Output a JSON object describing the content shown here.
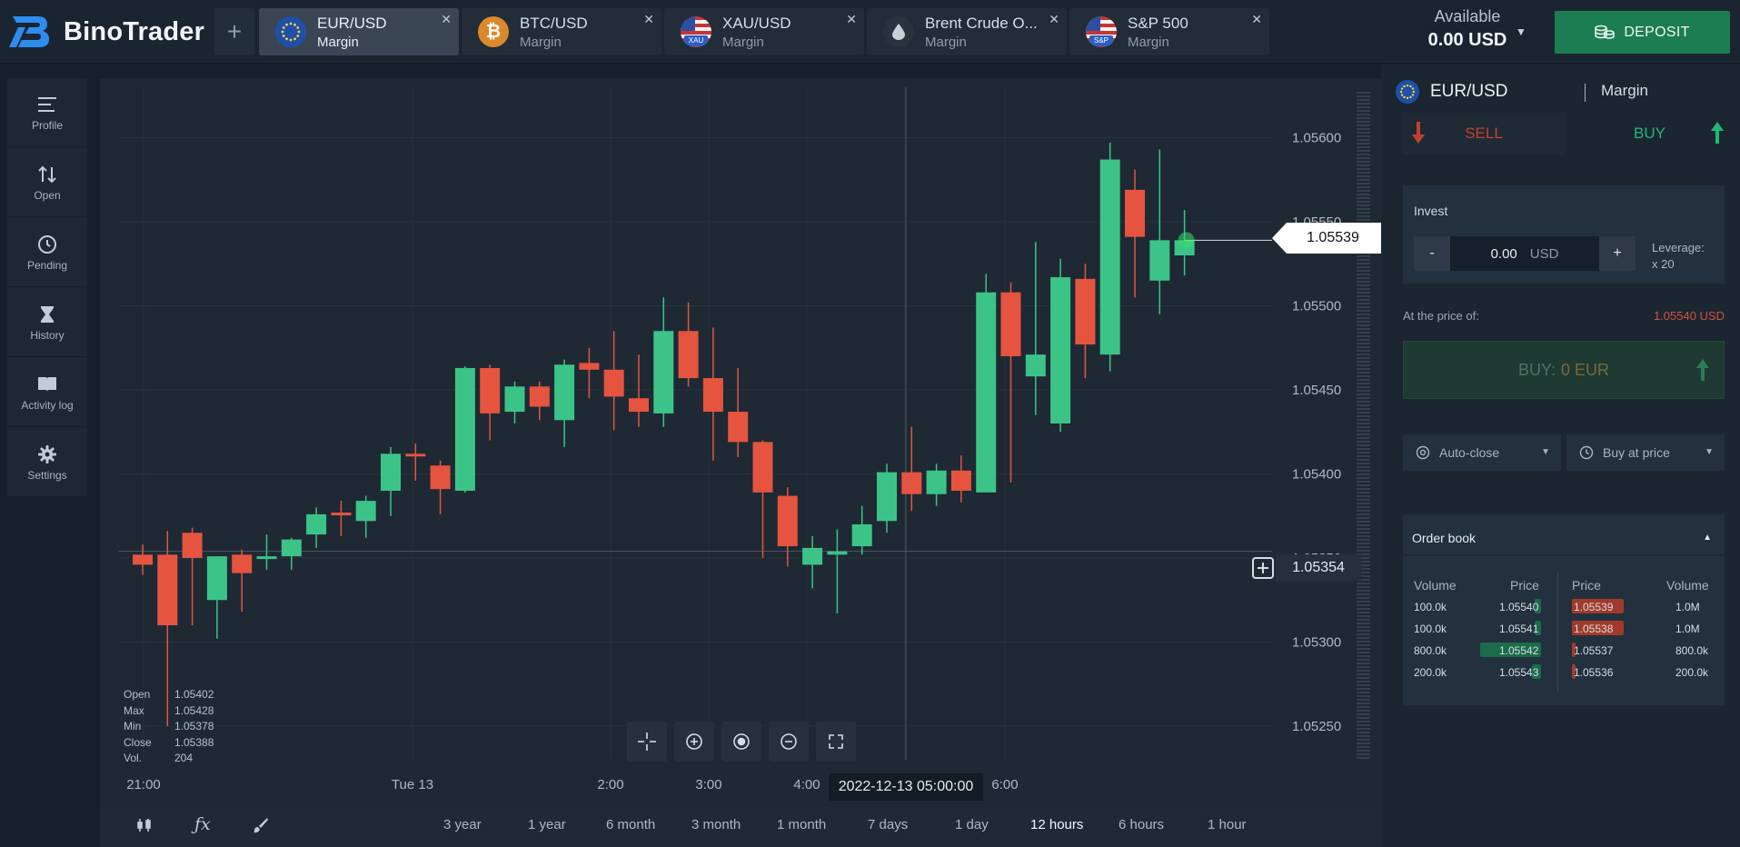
{
  "app": {
    "brand": "BinoTrader"
  },
  "tabs": [
    {
      "symbol": "EUR/USD",
      "mode": "Margin",
      "active": true,
      "flag": "eu-flag-icon"
    },
    {
      "symbol": "BTC/USD",
      "mode": "Margin",
      "active": false,
      "flag": "bitcoin-icon"
    },
    {
      "symbol": "XAU/USD",
      "mode": "Margin",
      "active": false,
      "flag": "us-flag-icon",
      "badge": "XAU"
    },
    {
      "symbol": "Brent Crude O...",
      "mode": "Margin",
      "active": false,
      "flag": "oil-drop-icon"
    },
    {
      "symbol": "S&P 500",
      "mode": "Margin",
      "active": false,
      "flag": "us-flag-icon",
      "badge": "S&P"
    }
  ],
  "account": {
    "available_label": "Available",
    "balance": "0.00 USD",
    "deposit_label": "DEPOSIT"
  },
  "nav": [
    {
      "label": "Profile",
      "icon": "menu-icon"
    },
    {
      "label": "Open",
      "icon": "sort-arrows-icon"
    },
    {
      "label": "Pending",
      "icon": "clock-icon"
    },
    {
      "label": "History",
      "icon": "hourglass-icon"
    },
    {
      "label": "Activity log",
      "icon": "book-icon"
    },
    {
      "label": "Settings",
      "icon": "gear-icon"
    }
  ],
  "chart": {
    "current_price": "1.05539",
    "crosshair_price": "1.05354",
    "crosshair_time": "2022-12-13 05:00:00",
    "ohlc": [
      {
        "k": "Open",
        "v": "1.05402"
      },
      {
        "k": "Max",
        "v": "1.05428"
      },
      {
        "k": "Min",
        "v": "1.05378"
      },
      {
        "k": "Close",
        "v": "1.05388"
      },
      {
        "k": "Vol.",
        "v": "204"
      }
    ]
  },
  "chart_data": {
    "type": "candlestick",
    "y_ticks": [
      "1.05600",
      "1.05550",
      "1.05500",
      "1.05450",
      "1.05400",
      "1.05350",
      "1.05300",
      "1.05250"
    ],
    "ylim": [
      1.0523,
      1.0563
    ],
    "x_ticks": [
      "21:00",
      "Tue 13",
      "2:00",
      "3:00",
      "4:00",
      "5:00",
      "6:00"
    ],
    "colors": {
      "up": "#3cc488",
      "down": "#e5543f"
    },
    "candles": [
      [
        1.05352,
        1.05346,
        1.05358,
        1.0534
      ],
      [
        1.05352,
        1.0531,
        1.05366,
        1.0525
      ],
      [
        1.05365,
        1.0535,
        1.05368,
        1.0531
      ],
      [
        1.05325,
        1.05351,
        1.05351,
        1.05302
      ],
      [
        1.05352,
        1.05341,
        1.05355,
        1.05318
      ],
      [
        1.0535,
        1.05351,
        1.05364,
        1.05343
      ],
      [
        1.05351,
        1.05361,
        1.05362,
        1.05343
      ],
      [
        1.05364,
        1.05376,
        1.0538,
        1.05356
      ],
      [
        1.05377,
        1.05376,
        1.05384,
        1.05363
      ],
      [
        1.05372,
        1.05384,
        1.05387,
        1.05362
      ],
      [
        1.0539,
        1.05412,
        1.05416,
        1.05375
      ],
      [
        1.05412,
        1.05411,
        1.05418,
        1.05396
      ],
      [
        1.05405,
        1.05391,
        1.05408,
        1.05376
      ],
      [
        1.0539,
        1.05463,
        1.05464,
        1.05389
      ],
      [
        1.05463,
        1.05436,
        1.05465,
        1.0542
      ],
      [
        1.05437,
        1.05452,
        1.05455,
        1.0543
      ],
      [
        1.05452,
        1.0544,
        1.05455,
        1.05432
      ],
      [
        1.05432,
        1.05465,
        1.05468,
        1.05416
      ],
      [
        1.05466,
        1.05462,
        1.05475,
        1.05445
      ],
      [
        1.05462,
        1.05446,
        1.05485,
        1.05426
      ],
      [
        1.05445,
        1.05437,
        1.05471,
        1.05428
      ],
      [
        1.05436,
        1.05485,
        1.05505,
        1.05428
      ],
      [
        1.05485,
        1.05457,
        1.05502,
        1.05452
      ],
      [
        1.05457,
        1.05437,
        1.05487,
        1.05408
      ],
      [
        1.05437,
        1.05419,
        1.05463,
        1.0541
      ],
      [
        1.05419,
        1.05389,
        1.0542,
        1.0535
      ],
      [
        1.05387,
        1.05357,
        1.05392,
        1.05345
      ],
      [
        1.05346,
        1.05356,
        1.05363,
        1.05332
      ],
      [
        1.05352,
        1.05354,
        1.05367,
        1.05317
      ],
      [
        1.05357,
        1.0537,
        1.05381,
        1.05352
      ],
      [
        1.05372,
        1.05401,
        1.05406,
        1.05365
      ],
      [
        1.05401,
        1.05388,
        1.05428,
        1.05378
      ],
      [
        1.05388,
        1.05402,
        1.05406,
        1.05381
      ],
      [
        1.05402,
        1.0539,
        1.05411,
        1.05383
      ],
      [
        1.05389,
        1.05508,
        1.05519,
        1.05399
      ],
      [
        1.05508,
        1.0547,
        1.05514,
        1.05395
      ],
      [
        1.05458,
        1.05471,
        1.05538,
        1.05435
      ],
      [
        1.0543,
        1.05517,
        1.05528,
        1.05425
      ],
      [
        1.05516,
        1.05477,
        1.05525,
        1.05457
      ],
      [
        1.05471,
        1.05587,
        1.05597,
        1.05461
      ],
      [
        1.05569,
        1.05541,
        1.05581,
        1.05505
      ],
      [
        1.05515,
        1.05539,
        1.05593,
        1.05495
      ],
      [
        1.0553,
        1.05539,
        1.05557,
        1.05518
      ]
    ]
  },
  "periods": [
    {
      "label": "3 year",
      "active": false
    },
    {
      "label": "1 year",
      "active": false
    },
    {
      "label": "6 month",
      "active": false
    },
    {
      "label": "3 month",
      "active": false
    },
    {
      "label": "1 month",
      "active": false
    },
    {
      "label": "7 days",
      "active": false
    },
    {
      "label": "1 day",
      "active": false
    },
    {
      "label": "12 hours",
      "active": true
    },
    {
      "label": "6 hours",
      "active": false
    },
    {
      "label": "1 hour",
      "active": false
    }
  ],
  "panel": {
    "symbol": "EUR/USD",
    "mode": "Margin",
    "sell_label": "SELL",
    "buy_label": "BUY",
    "invest_label": "Invest",
    "amount": "0.00",
    "currency": "USD",
    "minus": "-",
    "plus": "+",
    "leverage_label": "Leverage:",
    "leverage_value": "x 20",
    "at_price_label": "At the price of:",
    "at_price_value": "1.05540 USD",
    "buy_button_label": "BUY:",
    "buy_button_amount": "0 EUR",
    "autoclose_label": "Auto-close",
    "buyatprice_label": "Buy at price"
  },
  "orderbook": {
    "title": "Order book",
    "headers": [
      "Volume",
      "Price",
      "Price",
      "Volume"
    ],
    "rows": [
      {
        "bid_vol": "100.0k",
        "bid_price": "1.05540",
        "ask_price": "1.05539",
        "ask_vol": "1.0M",
        "bid_depth": 0.09,
        "ask_depth": 0.95
      },
      {
        "bid_vol": "100.0k",
        "bid_price": "1.05541",
        "ask_price": "1.05538",
        "ask_vol": "1.0M",
        "bid_depth": 0.09,
        "ask_depth": 0.95
      },
      {
        "bid_vol": "800.0k",
        "bid_price": "1.05542",
        "ask_price": "1.05537",
        "ask_vol": "800.0k",
        "bid_depth": 0.84,
        "ask_depth": 0.06
      },
      {
        "bid_vol": "200.0k",
        "bid_price": "1.05543",
        "ask_price": "1.05536",
        "ask_vol": "200.0k",
        "bid_depth": 0.13,
        "ask_depth": 0.06
      }
    ]
  }
}
